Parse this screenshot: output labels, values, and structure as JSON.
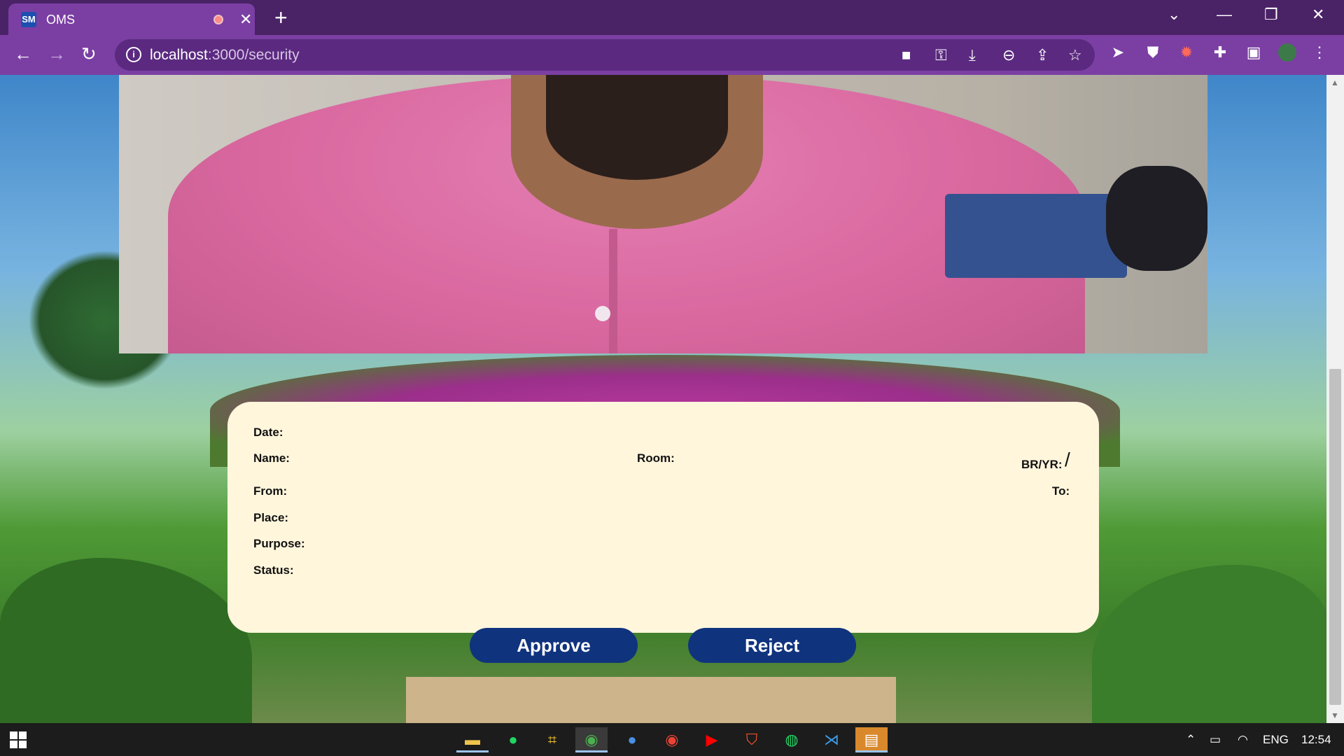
{
  "browser": {
    "tab": {
      "favicon": "SM",
      "title": "OMS"
    },
    "url": {
      "host": "localhost",
      "path": ":3000/security"
    }
  },
  "webcam": {
    "alt": "webcam-feed"
  },
  "card": {
    "date_label": "Date:",
    "name_label": "Name:",
    "room_label": "Room:",
    "bryr_label": "BR/YR:",
    "bryr_value": "/",
    "from_label": "From:",
    "to_label": "To:",
    "place_label": "Place:",
    "purpose_label": "Purpose:",
    "status_label": "Status:",
    "approve_button": "Approve",
    "reject_button": "Reject"
  },
  "taskbar": {
    "lang": "ENG",
    "time": "12:54"
  },
  "colors": {
    "chrome_dark": "#4a2266",
    "chrome_light": "#7b3fa3",
    "card_bg": "#fff6dc",
    "button_bg": "#10337e"
  }
}
